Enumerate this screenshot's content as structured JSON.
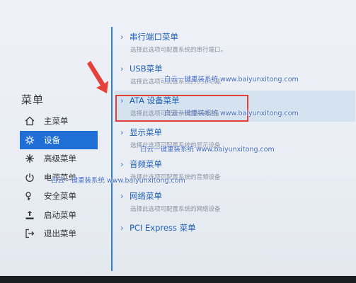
{
  "sidebar": {
    "title": "菜单",
    "items": [
      {
        "label": "主菜单",
        "icon": "home-icon"
      },
      {
        "label": "设备",
        "icon": "gear-icon",
        "active": true
      },
      {
        "label": "高级菜单",
        "icon": "advanced-icon"
      },
      {
        "label": "电源菜单",
        "icon": "power-icon"
      },
      {
        "label": "安全菜单",
        "icon": "shield-icon"
      },
      {
        "label": "启动菜单",
        "icon": "boot-icon"
      },
      {
        "label": "退出菜单",
        "icon": "exit-icon"
      }
    ]
  },
  "menu": {
    "items": [
      {
        "title": "串行端口菜单",
        "desc": "选择此选项可配置系统的串行端口。"
      },
      {
        "title": "USB菜单",
        "desc": "选择此选项可配置系统的USB功能"
      },
      {
        "title": "ATA 设备菜单",
        "desc": "选择此选项可配置系统的ATA设备",
        "highlight": true
      },
      {
        "title": "显示菜单",
        "desc": "选择此选项可配置系统的显示设备"
      },
      {
        "title": "音频菜单",
        "desc": "选择此选项可配置系统的音频设备"
      },
      {
        "title": "网络菜单",
        "desc": "选择此选项可配置系统的网络设备"
      },
      {
        "title": "PCI Express 菜单",
        "desc": ""
      }
    ]
  },
  "watermark": {
    "text": "白云一键重装系统 www.baiyunxitong.com"
  },
  "colors": {
    "accent": "#1f6fd6",
    "annotation": "#e5413b"
  }
}
